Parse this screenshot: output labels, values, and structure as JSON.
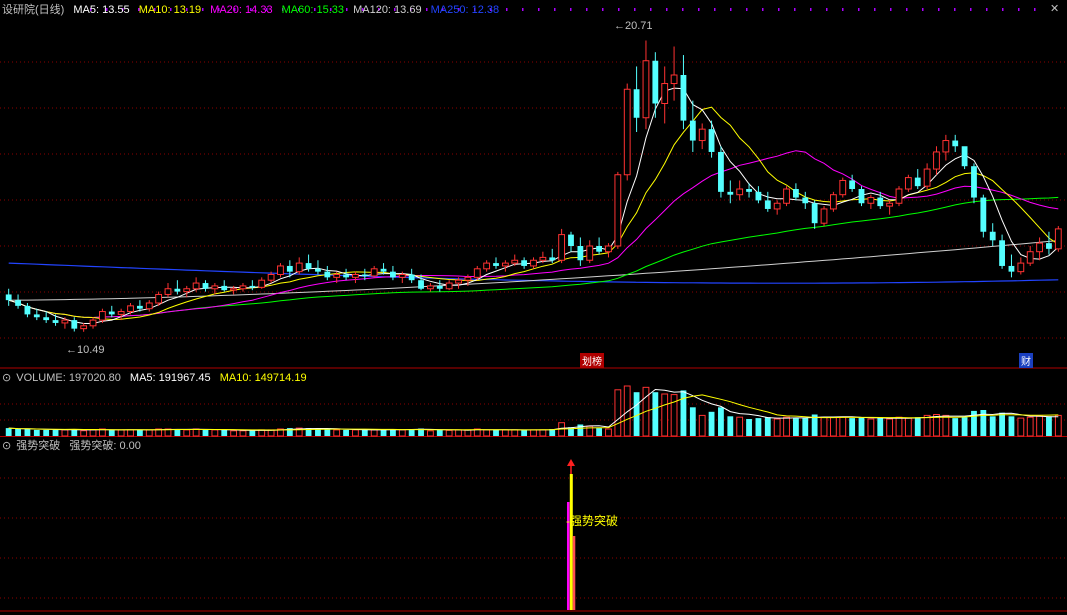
{
  "colors": {
    "up": "#ff3232",
    "down": "#54ffff",
    "ma5": "#ffffff",
    "ma10": "#ffff00",
    "ma20": "#ff00ff",
    "ma60": "#00ff00",
    "ma120": "#d0d0d0",
    "ma250": "#2244ff",
    "grid": "#8b0000",
    "label": "#c0c0c0"
  },
  "panel_main": {
    "title": "设研院(日线)",
    "indicators": [
      {
        "name": "MA5",
        "value": "13.55",
        "color": "#ffffff"
      },
      {
        "name": "MA10",
        "value": "13.19",
        "color": "#ffff00"
      },
      {
        "name": "MA20",
        "value": "14.33",
        "color": "#ff00ff"
      },
      {
        "name": "MA60",
        "value": "15.33",
        "color": "#00ff00"
      },
      {
        "name": "MA120",
        "value": "13.69",
        "color": "#d0d0d0"
      },
      {
        "name": "MA250",
        "value": "12.38",
        "color": "#2244ff"
      }
    ],
    "high_label": "20.71",
    "low_label": "10.49",
    "badge_a": "划榜",
    "badge_b": "财"
  },
  "panel_volume": {
    "title": "VOLUME: 197020.80",
    "ma5": "MA5: 191967.45",
    "ma10": "MA10: 149714.19"
  },
  "panel_signal": {
    "title": "强势突破",
    "readout": "强势突破: 0.00",
    "marker_label": "强势突破"
  },
  "chart_data": {
    "type": "candlestick",
    "ylim": [
      9.5,
      21.5
    ],
    "candles": [
      [
        11.8,
        12.0,
        11.4,
        11.6
      ],
      [
        11.6,
        11.8,
        11.3,
        11.4
      ],
      [
        11.4,
        11.5,
        11.0,
        11.1
      ],
      [
        11.1,
        11.3,
        10.9,
        11.0
      ],
      [
        11.0,
        11.2,
        10.8,
        10.9
      ],
      [
        10.9,
        11.1,
        10.7,
        10.8
      ],
      [
        10.8,
        11.0,
        10.6,
        10.9
      ],
      [
        10.9,
        11.0,
        10.5,
        10.6
      ],
      [
        10.6,
        10.8,
        10.49,
        10.7
      ],
      [
        10.7,
        11.0,
        10.6,
        10.9
      ],
      [
        10.9,
        11.3,
        10.8,
        11.2
      ],
      [
        11.2,
        11.4,
        11.0,
        11.1
      ],
      [
        11.1,
        11.3,
        10.9,
        11.2
      ],
      [
        11.2,
        11.5,
        11.1,
        11.4
      ],
      [
        11.4,
        11.6,
        11.2,
        11.3
      ],
      [
        11.3,
        11.6,
        11.2,
        11.5
      ],
      [
        11.5,
        11.9,
        11.4,
        11.8
      ],
      [
        11.8,
        12.2,
        11.7,
        12.0
      ],
      [
        12.0,
        12.3,
        11.8,
        11.9
      ],
      [
        11.9,
        12.1,
        11.7,
        12.0
      ],
      [
        12.0,
        12.4,
        11.9,
        12.2
      ],
      [
        12.2,
        12.3,
        11.9,
        12.0
      ],
      [
        12.0,
        12.2,
        11.8,
        12.1
      ],
      [
        12.1,
        12.3,
        11.9,
        11.95
      ],
      [
        11.95,
        12.1,
        11.8,
        12.0
      ],
      [
        12.0,
        12.2,
        11.9,
        12.1
      ],
      [
        12.1,
        12.3,
        11.95,
        12.05
      ],
      [
        12.05,
        12.4,
        12.0,
        12.3
      ],
      [
        12.3,
        12.6,
        12.2,
        12.5
      ],
      [
        12.5,
        12.9,
        12.4,
        12.8
      ],
      [
        12.8,
        13.0,
        12.4,
        12.6
      ],
      [
        12.6,
        13.1,
        12.5,
        12.9
      ],
      [
        12.9,
        13.2,
        12.6,
        12.7
      ],
      [
        12.7,
        13.0,
        12.5,
        12.6
      ],
      [
        12.6,
        12.8,
        12.3,
        12.4
      ],
      [
        12.4,
        12.6,
        12.2,
        12.5
      ],
      [
        12.5,
        12.7,
        12.3,
        12.4
      ],
      [
        12.4,
        12.6,
        12.2,
        12.5
      ],
      [
        12.5,
        12.7,
        12.3,
        12.45
      ],
      [
        12.45,
        12.8,
        12.4,
        12.7
      ],
      [
        12.7,
        12.9,
        12.5,
        12.6
      ],
      [
        12.6,
        12.8,
        12.3,
        12.4
      ],
      [
        12.4,
        12.6,
        12.2,
        12.5
      ],
      [
        12.5,
        12.7,
        12.2,
        12.3
      ],
      [
        12.3,
        12.5,
        11.95,
        12.0
      ],
      [
        12.0,
        12.2,
        11.9,
        12.1
      ],
      [
        12.1,
        12.3,
        11.9,
        12.0
      ],
      [
        12.0,
        12.3,
        11.95,
        12.2
      ],
      [
        12.2,
        12.4,
        12.0,
        12.3
      ],
      [
        12.3,
        12.5,
        12.1,
        12.4
      ],
      [
        12.4,
        12.8,
        12.3,
        12.7
      ],
      [
        12.7,
        13.0,
        12.6,
        12.9
      ],
      [
        12.9,
        13.1,
        12.7,
        12.8
      ],
      [
        12.8,
        13.0,
        12.6,
        12.9
      ],
      [
        12.9,
        13.2,
        12.8,
        13.0
      ],
      [
        13.0,
        13.1,
        12.7,
        12.8
      ],
      [
        12.8,
        13.1,
        12.7,
        13.0
      ],
      [
        13.0,
        13.3,
        12.9,
        13.1
      ],
      [
        13.1,
        13.4,
        12.9,
        13.0
      ],
      [
        13.0,
        14.1,
        12.9,
        13.9
      ],
      [
        13.9,
        14.0,
        13.3,
        13.5
      ],
      [
        13.5,
        13.8,
        12.8,
        13.0
      ],
      [
        13.0,
        13.7,
        12.9,
        13.5
      ],
      [
        13.5,
        13.8,
        13.2,
        13.3
      ],
      [
        13.3,
        13.6,
        13.1,
        13.5
      ],
      [
        13.5,
        16.1,
        13.4,
        16.0
      ],
      [
        16.0,
        19.2,
        15.8,
        19.0
      ],
      [
        19.0,
        19.8,
        17.5,
        18.0
      ],
      [
        18.0,
        20.71,
        17.6,
        20.0
      ],
      [
        20.0,
        20.3,
        18.0,
        18.5
      ],
      [
        18.5,
        19.8,
        17.8,
        19.2
      ],
      [
        19.2,
        20.5,
        18.6,
        19.5
      ],
      [
        19.5,
        20.2,
        17.6,
        17.9
      ],
      [
        17.9,
        18.6,
        16.8,
        17.2
      ],
      [
        17.2,
        17.8,
        16.9,
        17.6
      ],
      [
        17.6,
        17.9,
        16.6,
        16.8
      ],
      [
        16.8,
        17.0,
        15.2,
        15.4
      ],
      [
        15.4,
        15.8,
        15.0,
        15.3
      ],
      [
        15.3,
        15.8,
        15.1,
        15.5
      ],
      [
        15.5,
        15.7,
        15.2,
        15.4
      ],
      [
        15.4,
        15.6,
        15.0,
        15.1
      ],
      [
        15.1,
        15.4,
        14.7,
        14.8
      ],
      [
        14.8,
        15.1,
        14.6,
        15.0
      ],
      [
        15.0,
        15.6,
        14.9,
        15.5
      ],
      [
        15.5,
        15.7,
        15.1,
        15.2
      ],
      [
        15.2,
        15.4,
        14.8,
        15.0
      ],
      [
        15.0,
        15.1,
        14.1,
        14.3
      ],
      [
        14.3,
        14.9,
        14.2,
        14.8
      ],
      [
        14.8,
        15.4,
        14.7,
        15.3
      ],
      [
        15.3,
        15.9,
        15.2,
        15.8
      ],
      [
        15.8,
        16.0,
        15.4,
        15.5
      ],
      [
        15.5,
        15.6,
        14.9,
        15.0
      ],
      [
        15.0,
        15.3,
        14.8,
        15.2
      ],
      [
        15.2,
        15.4,
        14.8,
        14.9
      ],
      [
        14.9,
        15.1,
        14.6,
        15.0
      ],
      [
        15.0,
        15.6,
        14.9,
        15.5
      ],
      [
        15.5,
        16.0,
        15.4,
        15.9
      ],
      [
        15.9,
        16.2,
        15.5,
        15.6
      ],
      [
        15.6,
        16.4,
        15.5,
        16.2
      ],
      [
        16.2,
        17.0,
        16.0,
        16.8
      ],
      [
        16.8,
        17.4,
        16.5,
        17.2
      ],
      [
        17.2,
        17.4,
        16.8,
        17.0
      ],
      [
        17.0,
        16.9,
        16.2,
        16.3
      ],
      [
        16.3,
        16.4,
        15.0,
        15.2
      ],
      [
        15.2,
        15.3,
        13.8,
        14.0
      ],
      [
        14.0,
        14.3,
        13.5,
        13.7
      ],
      [
        13.7,
        13.9,
        12.7,
        12.8
      ],
      [
        12.8,
        13.2,
        12.4,
        12.6
      ],
      [
        12.6,
        13.1,
        12.5,
        12.9
      ],
      [
        12.9,
        13.5,
        12.8,
        13.3
      ],
      [
        13.3,
        13.8,
        13.0,
        13.6
      ],
      [
        13.6,
        14.0,
        13.2,
        13.4
      ],
      [
        13.4,
        14.2,
        13.3,
        14.1
      ]
    ],
    "signal_index": 60
  }
}
